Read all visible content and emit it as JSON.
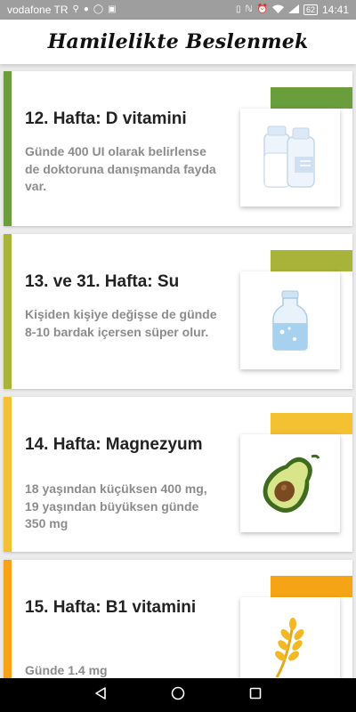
{
  "status_bar": {
    "carrier": "vodafone TR",
    "battery": "62",
    "time": "14:41"
  },
  "app": {
    "title": "Hamilelikte Beslenmek"
  },
  "cards": [
    {
      "title": "12. Hafta: D vitamini",
      "description": "Günde 400 UI olarak belirlense de doktoruna danışmanda fayda var.",
      "accent": "#6a9e3c",
      "icon": "milk-bottles-icon"
    },
    {
      "title": "13. ve 31. Hafta: Su",
      "description": "Kişiden kişiye değişse de günde 8-10 bardak içersen süper olur.",
      "accent": "#a8b33a",
      "icon": "water-bottle-icon"
    },
    {
      "title": "14. Hafta: Magnezyum",
      "description": "18 yaşından küçüksen 400 mg, 19 yaşından büyüksen günde 350 mg",
      "accent": "#f4c132",
      "icon": "avocado-icon"
    },
    {
      "title": "15. Hafta: B1 vitamini",
      "description": "Günde 1.4 mg",
      "accent": "#f5a416",
      "icon": "wheat-icon"
    }
  ]
}
